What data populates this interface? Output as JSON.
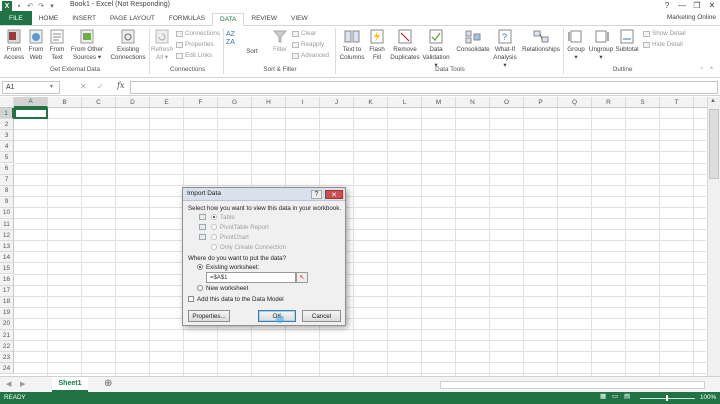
{
  "window": {
    "title": "Book1 - Excel (Not Responding)",
    "logo": "X",
    "help_symbol": "?",
    "minimize_symbol": "—",
    "restore_symbol": "❐",
    "close_symbol": "✕"
  },
  "ribbon_tabs": [
    "FILE",
    "HOME",
    "INSERT",
    "PAGE LAYOUT",
    "FORMULAS",
    "DATA",
    "REVIEW",
    "VIEW"
  ],
  "active_tab": "DATA",
  "user": "Marketing Online",
  "ribbon": {
    "get_external_data": {
      "label": "Get External Data",
      "buttons": [
        {
          "label1": "From",
          "label2": "Access"
        },
        {
          "label1": "From",
          "label2": "Web"
        },
        {
          "label1": "From",
          "label2": "Text"
        },
        {
          "label1": "From Other",
          "label2": "Sources ▾"
        },
        {
          "label1": "Existing",
          "label2": "Connections"
        }
      ]
    },
    "connections": {
      "label": "Connections",
      "refresh1": "Refresh",
      "refresh2": "All ▾",
      "items": [
        "Connections",
        "Properties",
        "Edit Links"
      ]
    },
    "sort_filter": {
      "label": "Sort & Filter",
      "sort": "Sort",
      "filter": "Filter",
      "items": [
        "Clear",
        "Reapply",
        "Advanced"
      ]
    },
    "data_tools": {
      "label": "Data Tools",
      "buttons": [
        {
          "label1": "Text to",
          "label2": "Columns"
        },
        {
          "label1": "Flash",
          "label2": "Fill"
        },
        {
          "label1": "Remove",
          "label2": "Duplicates"
        },
        {
          "label1": "Data",
          "label2": "Validation ▾"
        },
        {
          "label1": "Consolidate",
          "label2": ""
        },
        {
          "label1": "What-If",
          "label2": "Analysis ▾"
        },
        {
          "label1": "Relationships",
          "label2": ""
        }
      ]
    },
    "outline": {
      "label": "Outline",
      "buttons": [
        {
          "label1": "Group",
          "label2": "▾"
        },
        {
          "label1": "Ungroup",
          "label2": "▾"
        },
        {
          "label1": "Subtotal",
          "label2": ""
        }
      ],
      "items": [
        "Show Detail",
        "Hide Detail"
      ]
    }
  },
  "formula_bar": {
    "name_box": "A1",
    "fx": "fx",
    "cancel_symbol": "✕",
    "enter_symbol": "✓",
    "value": ""
  },
  "grid": {
    "columns": [
      "A",
      "B",
      "C",
      "D",
      "E",
      "F",
      "G",
      "H",
      "I",
      "J",
      "K",
      "L",
      "M",
      "N",
      "O",
      "P",
      "Q",
      "R",
      "S",
      "T",
      "U"
    ],
    "rows": [
      "1",
      "2",
      "3",
      "4",
      "5",
      "6",
      "7",
      "8",
      "9",
      "10",
      "11",
      "12",
      "13",
      "14",
      "15",
      "16",
      "17",
      "18",
      "19",
      "20",
      "21",
      "22",
      "23",
      "24"
    ]
  },
  "sheets": [
    "Sheet1"
  ],
  "add_sheet_symbol": "⊕",
  "status": {
    "ready": "READY",
    "zoom": "100%"
  },
  "dialog": {
    "title": "Import Data",
    "help": "?",
    "close": "✕",
    "prompt": "Select how you want to view this data in your workbook.",
    "view_options": [
      {
        "label": "Table",
        "selected": true
      },
      {
        "label": "PivotTable Report",
        "selected": false
      },
      {
        "label": "PivotChart",
        "selected": false
      },
      {
        "label": "Only Create Connection",
        "selected": false
      }
    ],
    "location_prompt": "Where do you want to put the data?",
    "existing_label": "Existing worksheet:",
    "existing_value": "=$A$1",
    "new_label": "New worksheet",
    "data_model_label": "Add this data to the Data Model",
    "properties_button": "Properties...",
    "ok_button": "OK",
    "cancel_button": "Cancel"
  },
  "colors": {
    "excel_green": "#217346",
    "dialog_bg": "#f0f0f0"
  }
}
